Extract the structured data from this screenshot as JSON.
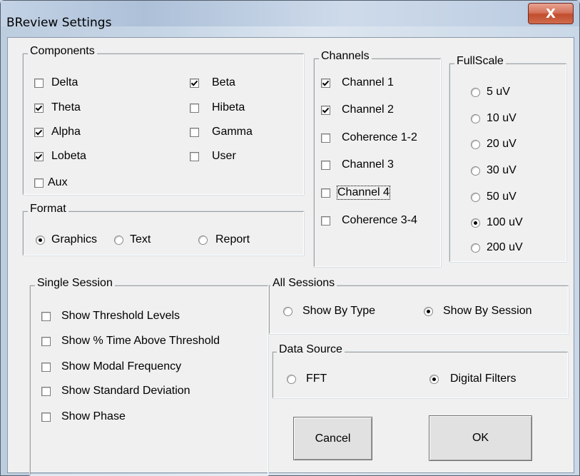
{
  "window": {
    "title": "BReview Settings",
    "close_glyph": "X"
  },
  "components": {
    "legend": "Components",
    "items": [
      {
        "label": "Delta",
        "checked": false
      },
      {
        "label": "Theta",
        "checked": true
      },
      {
        "label": "Alpha",
        "checked": true
      },
      {
        "label": "Lobeta",
        "checked": true
      },
      {
        "label": "Aux",
        "checked": false
      },
      {
        "label": "Beta",
        "checked": true
      },
      {
        "label": "Hibeta",
        "checked": false
      },
      {
        "label": "Gamma",
        "checked": false
      },
      {
        "label": "User",
        "checked": false
      }
    ]
  },
  "format": {
    "legend": "Format",
    "options": [
      {
        "label": "Graphics",
        "selected": true
      },
      {
        "label": "Text",
        "selected": false
      },
      {
        "label": "Report",
        "selected": false
      }
    ]
  },
  "channels": {
    "legend": "Channels",
    "items": [
      {
        "label": "Channel 1",
        "checked": true
      },
      {
        "label": "Channel 2",
        "checked": true
      },
      {
        "label": "Coherence 1-2",
        "checked": false
      },
      {
        "label": "Channel 3",
        "checked": false
      },
      {
        "label": "Channel 4",
        "checked": false
      },
      {
        "label": "Coherence 3-4",
        "checked": false
      }
    ]
  },
  "fullscale": {
    "legend": "FullScale",
    "options": [
      {
        "label": "5 uV",
        "selected": false
      },
      {
        "label": "10 uV",
        "selected": false
      },
      {
        "label": "20 uV",
        "selected": false
      },
      {
        "label": "30 uV",
        "selected": false
      },
      {
        "label": "50 uV",
        "selected": false
      },
      {
        "label": "100 uV",
        "selected": true
      },
      {
        "label": "200 uV",
        "selected": false
      }
    ]
  },
  "single_session": {
    "legend": "Single Session",
    "items": [
      {
        "label": "Show Threshold Levels",
        "checked": false
      },
      {
        "label": "Show % Time Above Threshold",
        "checked": false
      },
      {
        "label": "Show Modal Frequency",
        "checked": false
      },
      {
        "label": "Show Standard Deviation",
        "checked": false
      },
      {
        "label": "Show Phase",
        "checked": false
      }
    ]
  },
  "all_sessions": {
    "legend": "All Sessions",
    "options": [
      {
        "label": "Show By Type",
        "selected": false
      },
      {
        "label": "Show By Session",
        "selected": true
      }
    ]
  },
  "data_source": {
    "legend": "Data Source",
    "options": [
      {
        "label": "FFT",
        "selected": false
      },
      {
        "label": "Digital Filters",
        "selected": true
      }
    ]
  },
  "buttons": {
    "cancel": "Cancel",
    "ok": "OK"
  }
}
